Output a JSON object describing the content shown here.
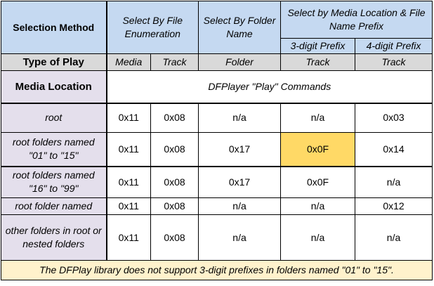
{
  "header": {
    "selection_method": "Selection Method",
    "by_file_enum": "Select By File Enumeration",
    "by_folder_name": "Select By Folder Name",
    "by_media_prefix": "Select by Media Location & File Name Prefix",
    "prefix3": "3-digit Prefix",
    "prefix4": "4-digit Prefix"
  },
  "type_row": {
    "label": "Type of Play",
    "media": "Media",
    "track": "Track",
    "folder": "Folder",
    "track3": "Track",
    "track4": "Track"
  },
  "location_row": {
    "label": "Media Location",
    "commands": "DFPlayer \"Play\" Commands"
  },
  "rows": [
    {
      "location": "root",
      "media": "0x11",
      "track": "0x08",
      "folder": "n/a",
      "p3": "n/a",
      "p4": "0x03"
    },
    {
      "location": "root folders named \"01\" to \"15\"",
      "media": "0x11",
      "track": "0x08",
      "folder": "0x17",
      "p3": "0x0F",
      "p4": "0x14"
    },
    {
      "location": "root folders named \"16\" to \"99\"",
      "media": "0x11",
      "track": "0x08",
      "folder": "0x17",
      "p3": "0x0F",
      "p4": "n/a"
    },
    {
      "location": "root folder named",
      "media": "0x11",
      "track": "0x08",
      "folder": "n/a",
      "p3": "n/a",
      "p4": "0x12"
    },
    {
      "location": "other folders in root or nested folders",
      "media": "0x11",
      "track": "0x08",
      "folder": "n/a",
      "p3": "n/a",
      "p4": "n/a"
    }
  ],
  "footer": "The DFPlay library does not support 3-digit prefixes in folders named \"01\" to \"15\".",
  "colors": {
    "header_blue": "#c5d9f1",
    "header_gray": "#d9d9d9",
    "location_lavender": "#e4dfec",
    "highlight_yellow": "#ffd966",
    "footer_yellow": "#fff2cc"
  }
}
